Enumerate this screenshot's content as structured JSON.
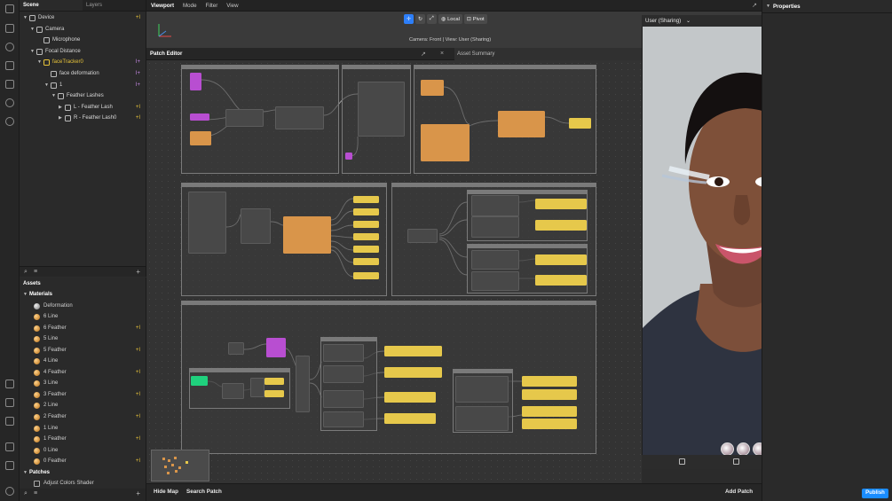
{
  "scene_panel": {
    "tabs": [
      "Scene",
      "Layers"
    ],
    "tree": [
      {
        "label": "Device",
        "indent": 0,
        "icon": "device-icon",
        "tag": "+I"
      },
      {
        "label": "Camera",
        "indent": 1,
        "icon": "camera-icon",
        "tag": ""
      },
      {
        "label": "Microphone",
        "indent": 2,
        "icon": "microphone-icon",
        "tag": ""
      },
      {
        "label": "Focal Distance",
        "indent": 1,
        "icon": "focal-distance-icon",
        "tag": ""
      },
      {
        "label": "faceTracker0",
        "indent": 2,
        "icon": "face-tracker-icon",
        "tag": "I+",
        "color": "yellow"
      },
      {
        "label": "face deformation",
        "indent": 3,
        "icon": "face-mesh-icon",
        "tag": "I+",
        "color": "purple"
      },
      {
        "label": "1",
        "indent": 3,
        "icon": "null-object-icon",
        "tag": "I+",
        "color": "purple"
      },
      {
        "label": "Feather Lashes",
        "indent": 4,
        "icon": "group-icon",
        "tag": ""
      },
      {
        "label": "L - Feather Lash",
        "indent": 5,
        "icon": "cube-icon",
        "tag": "+I"
      },
      {
        "label": "R - Feather Lash0",
        "indent": 5,
        "icon": "cube-icon",
        "tag": "+I"
      }
    ]
  },
  "assets": {
    "title": "Assets",
    "groups": [
      {
        "label": "Materials",
        "items": [
          {
            "label": "Deformation",
            "tag": "",
            "kind": "grey"
          },
          {
            "label": "6 Line",
            "tag": "",
            "kind": "orange"
          },
          {
            "label": "6 Feather",
            "tag": "+I",
            "kind": "orange"
          },
          {
            "label": "5 Line",
            "tag": "",
            "kind": "orange"
          },
          {
            "label": "5 Feather",
            "tag": "+I",
            "kind": "orange"
          },
          {
            "label": "4 Line",
            "tag": "",
            "kind": "orange"
          },
          {
            "label": "4 Feather",
            "tag": "+I",
            "kind": "orange"
          },
          {
            "label": "3 Line",
            "tag": "",
            "kind": "orange"
          },
          {
            "label": "3 Feather",
            "tag": "+I",
            "kind": "orange"
          },
          {
            "label": "2 Line",
            "tag": "",
            "kind": "orange"
          },
          {
            "label": "2 Feather",
            "tag": "+I",
            "kind": "orange"
          },
          {
            "label": "1 Line",
            "tag": "",
            "kind": "orange"
          },
          {
            "label": "1 Feather",
            "tag": "+I",
            "kind": "orange"
          },
          {
            "label": "0 Line",
            "tag": "",
            "kind": "orange"
          },
          {
            "label": "0 Feather",
            "tag": "+I",
            "kind": "orange"
          }
        ]
      },
      {
        "label": "Patches",
        "items": [
          {
            "label": "Adjust Colors Shader",
            "tag": "",
            "kind": "patch"
          }
        ]
      }
    ]
  },
  "viewport": {
    "menu": [
      "Viewport",
      "Mode",
      "Filter",
      "View"
    ],
    "local_label": "Local",
    "pivot_label": "Pivot",
    "camera_caption": "Camera: Front | View: User (Sharing)"
  },
  "patch_editor": {
    "title": "Patch Editor",
    "asset_summary": "Asset Summary",
    "hide_map": "Hide Map",
    "search_patch": "Search Patch",
    "add_patch": "Add Patch"
  },
  "simulator": {
    "view_label": "User (Sharing)"
  },
  "properties": {
    "title": "Properties",
    "publish_label": "Publish"
  },
  "colors": {
    "accent": "#2d7ff9",
    "publish": "#1a8cff",
    "node_orange": "#d9954a",
    "node_yellow": "#e6c84b",
    "node_purple": "#b84ed1",
    "node_green": "#1fd17d"
  }
}
